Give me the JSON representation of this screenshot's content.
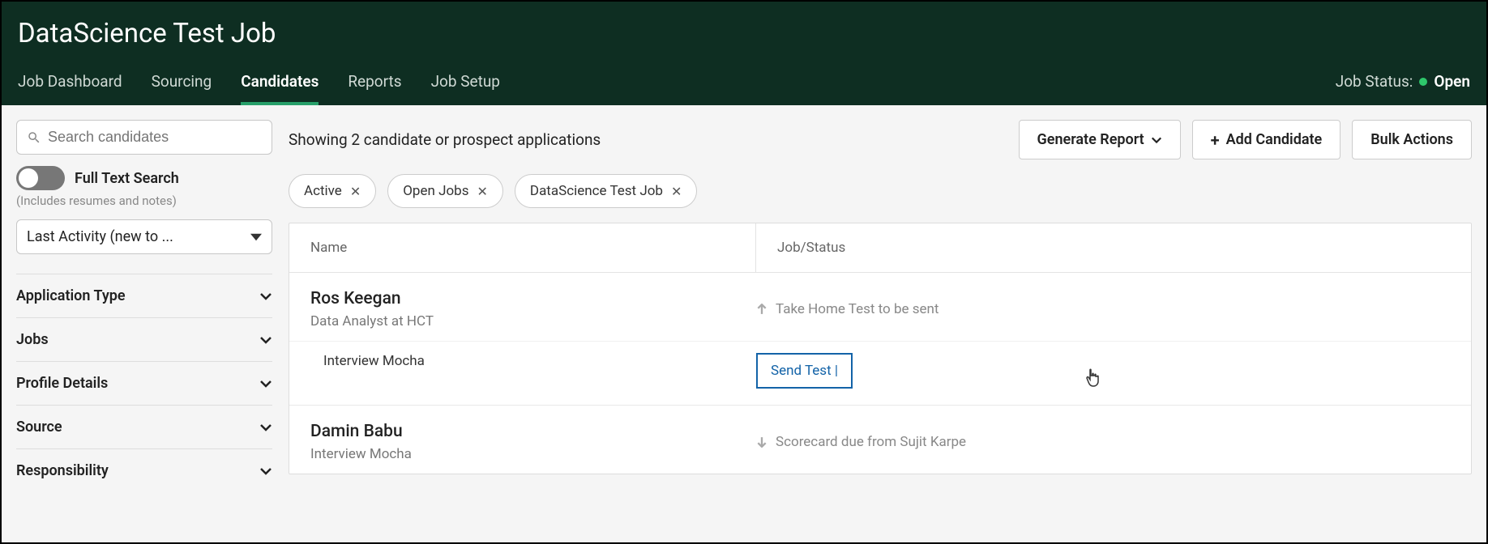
{
  "header": {
    "title": "DataScience Test Job",
    "tabs": [
      {
        "label": "Job Dashboard"
      },
      {
        "label": "Sourcing"
      },
      {
        "label": "Candidates"
      },
      {
        "label": "Reports"
      },
      {
        "label": "Job Setup"
      }
    ],
    "active_tab_index": 2,
    "status_label": "Job Status:",
    "status_value": "Open"
  },
  "sidebar": {
    "search_placeholder": "Search candidates",
    "full_text_label": "Full Text Search",
    "full_text_help": "(Includes resumes and notes)",
    "full_text_on": false,
    "sort_label": "Last Activity (new to ...",
    "filters": [
      {
        "label": "Application Type"
      },
      {
        "label": "Jobs"
      },
      {
        "label": "Profile Details"
      },
      {
        "label": "Source"
      },
      {
        "label": "Responsibility"
      }
    ]
  },
  "main": {
    "results_text": "Showing 2 candidate or prospect applications",
    "buttons": {
      "generate_report": "Generate Report",
      "add_candidate": "Add Candidate",
      "bulk_actions": "Bulk Actions"
    },
    "chips": [
      {
        "label": "Active"
      },
      {
        "label": "Open Jobs"
      },
      {
        "label": "DataScience Test Job"
      }
    ],
    "columns": {
      "name": "Name",
      "status": "Job/Status"
    },
    "rows": [
      {
        "name": "Ros Keegan",
        "title": "Data Analyst at HCT",
        "status": "Take Home Test to be sent",
        "status_dir": "up",
        "sub_label": "Interview Mocha",
        "action_label": "Send Test"
      },
      {
        "name": "Damin Babu",
        "title": "Interview Mocha",
        "status": "Scorecard due from Sujit Karpe",
        "status_dir": "down"
      }
    ]
  }
}
